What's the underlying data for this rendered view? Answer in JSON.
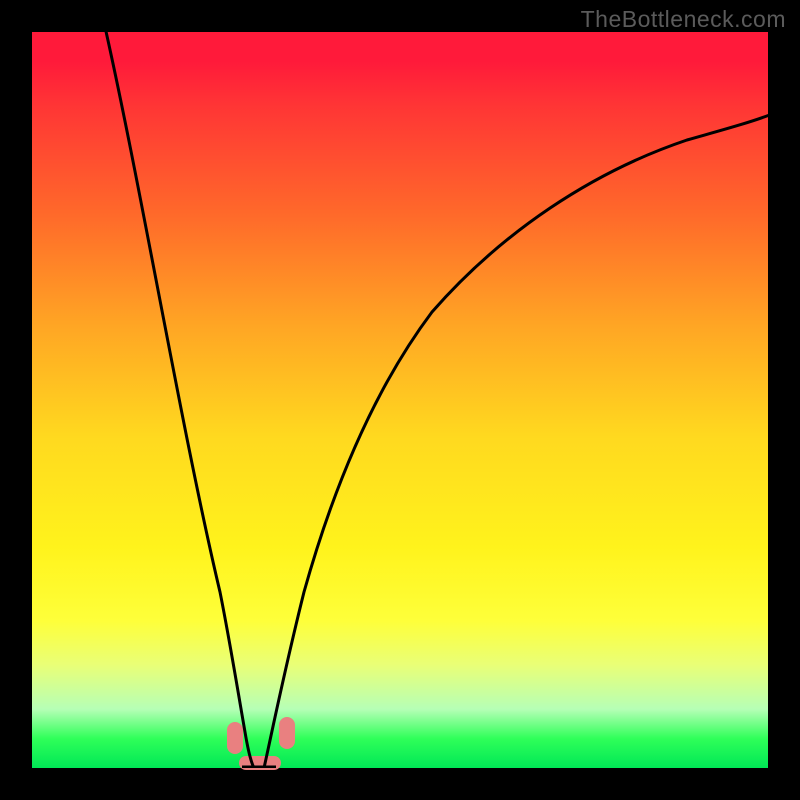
{
  "watermark": "TheBottleneck.com",
  "chart_data": {
    "type": "line",
    "title": "",
    "xlabel": "",
    "ylabel": "",
    "xlim": [
      0,
      100
    ],
    "ylim": [
      0,
      100
    ],
    "left_branch": {
      "x": [
        10,
        12,
        15,
        18,
        20,
        22,
        24,
        25,
        26,
        27.5,
        29
      ],
      "y": [
        100,
        84,
        64,
        48,
        38,
        28,
        18,
        12,
        7,
        3,
        0
      ]
    },
    "right_branch": {
      "x": [
        31,
        32,
        34,
        37,
        40,
        45,
        50,
        55,
        62,
        70,
        80,
        90,
        100
      ],
      "y": [
        0,
        3,
        10,
        22,
        32,
        46,
        55,
        62,
        70,
        76,
        82,
        86,
        89
      ]
    },
    "plateau": {
      "x_start": 29,
      "x_end": 31,
      "y": 0
    },
    "markers": [
      {
        "x": 27.5,
        "y": 3,
        "shape": "pill-vertical"
      },
      {
        "x": 34.5,
        "y": 4,
        "shape": "pill-vertical"
      },
      {
        "x": 30,
        "y": 0,
        "shape": "pill-horizontal"
      }
    ],
    "background": {
      "type": "vertical-gradient",
      "top_color": "#ff1a3a",
      "mid_color": "#fff31c",
      "bottom_color": "#00e756"
    }
  }
}
